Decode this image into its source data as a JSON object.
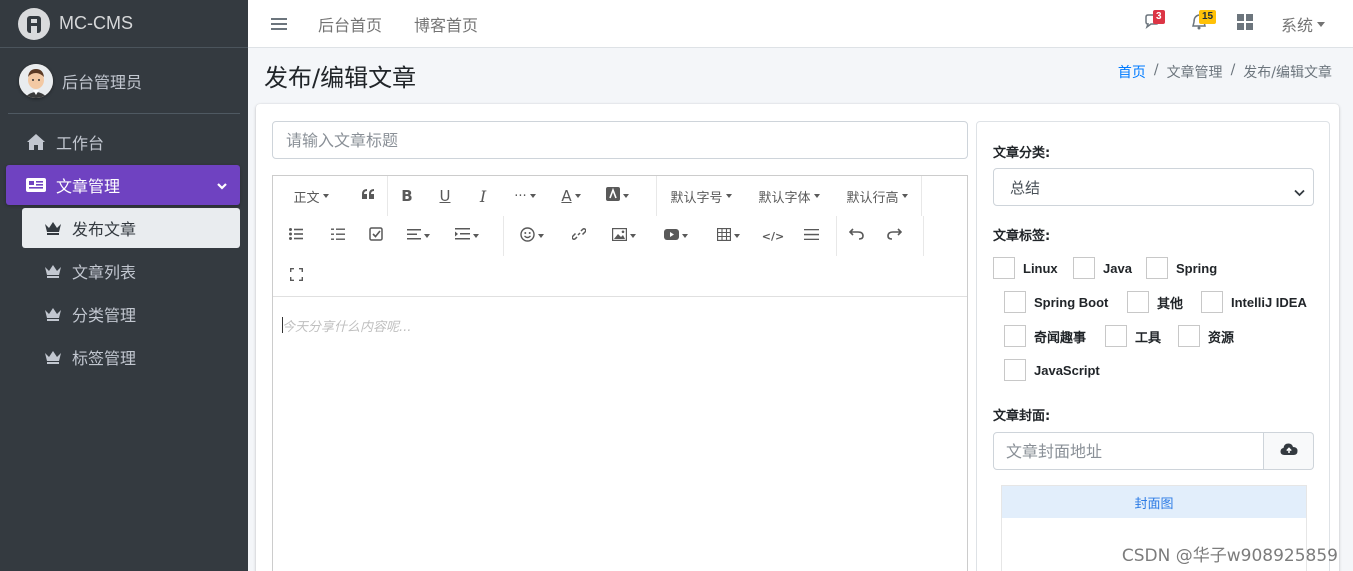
{
  "brand": {
    "name": "MC-CMS"
  },
  "user": {
    "name": "后台管理员"
  },
  "sidebar": {
    "items": [
      {
        "label": "工作台"
      },
      {
        "label": "文章管理"
      }
    ],
    "subitems": [
      {
        "label": "发布文章"
      },
      {
        "label": "文章列表"
      },
      {
        "label": "分类管理"
      },
      {
        "label": "标签管理"
      }
    ]
  },
  "topbar": {
    "links": [
      "后台首页",
      "博客首页"
    ],
    "messages_count": "3",
    "notifications_count": "15",
    "system_label": "系统"
  },
  "page": {
    "title": "发布/编辑文章",
    "breadcrumb": [
      "首页",
      "文章管理",
      "发布/编辑文章"
    ]
  },
  "editor": {
    "title_placeholder": "请输入文章标题",
    "toolbar": {
      "paragraph": "正文",
      "font_size": "默认字号",
      "font_family": "默认字体",
      "line_height": "默认行高"
    },
    "content_placeholder": "今天分享什么内容呢..."
  },
  "form": {
    "category_label": "文章分类:",
    "category_value": "总结",
    "tags_label": "文章标签:",
    "tags": [
      "Linux",
      "Java",
      "Spring",
      "Spring Boot",
      "其他",
      "IntelliJ IDEA",
      "奇闻趣事",
      "工具",
      "资源",
      "JavaScript"
    ],
    "cover_label": "文章封面:",
    "cover_placeholder": "文章封面地址",
    "cover_preview_title": "封面图"
  },
  "colors": {
    "sidebar_bg": "#343a40",
    "active_nav": "#6f42c1",
    "link": "#007bff",
    "badge_red": "#dc3545",
    "badge_yellow": "#ffc107"
  },
  "watermark": "CSDN @华子w908925859"
}
